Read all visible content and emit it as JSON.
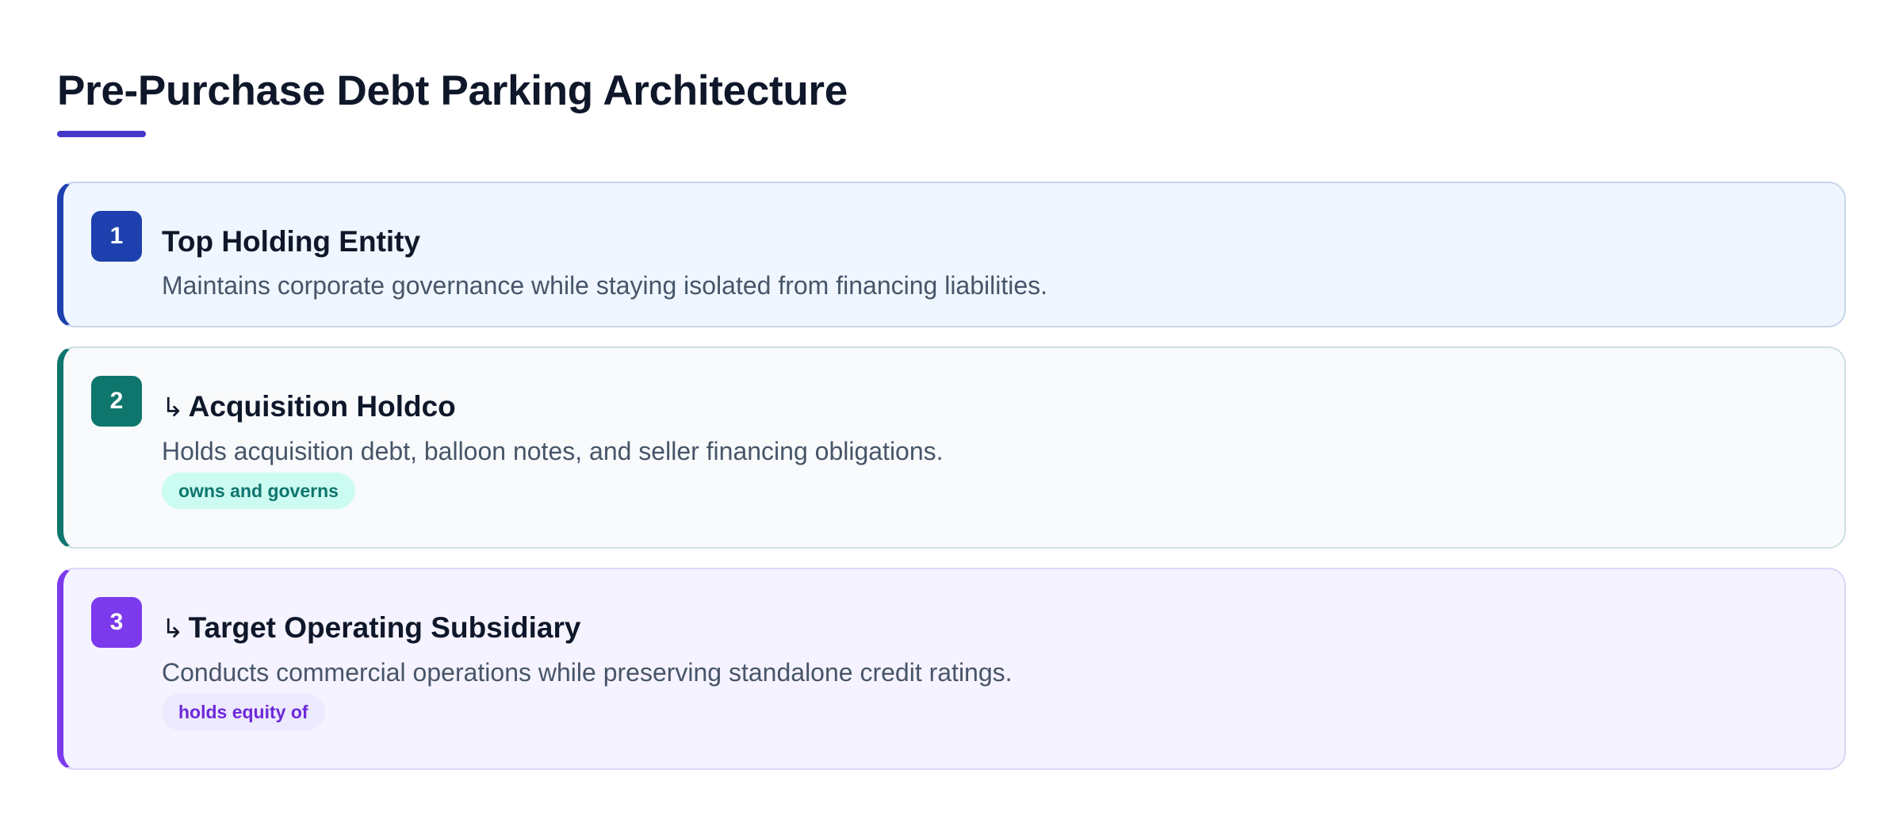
{
  "title": "Pre-Purchase Debt Parking Architecture",
  "colors": {
    "accent": "#4338ca",
    "card1": "#1e40af",
    "card2": "#0f766e",
    "card3": "#7c3aed"
  },
  "cards": [
    {
      "number": "1",
      "arrow": "",
      "title": "Top Holding Entity",
      "description": "Maintains corporate governance while staying isolated from financing liabilities.",
      "tag": ""
    },
    {
      "number": "2",
      "arrow": "↳",
      "title": "Acquisition Holdco",
      "description": "Holds acquisition debt, balloon notes, and seller financing obligations.",
      "tag": "owns and governs"
    },
    {
      "number": "3",
      "arrow": "↳",
      "title": "Target Operating Subsidiary",
      "description": "Conducts commercial operations while preserving standalone credit ratings.",
      "tag": "holds equity of"
    }
  ]
}
